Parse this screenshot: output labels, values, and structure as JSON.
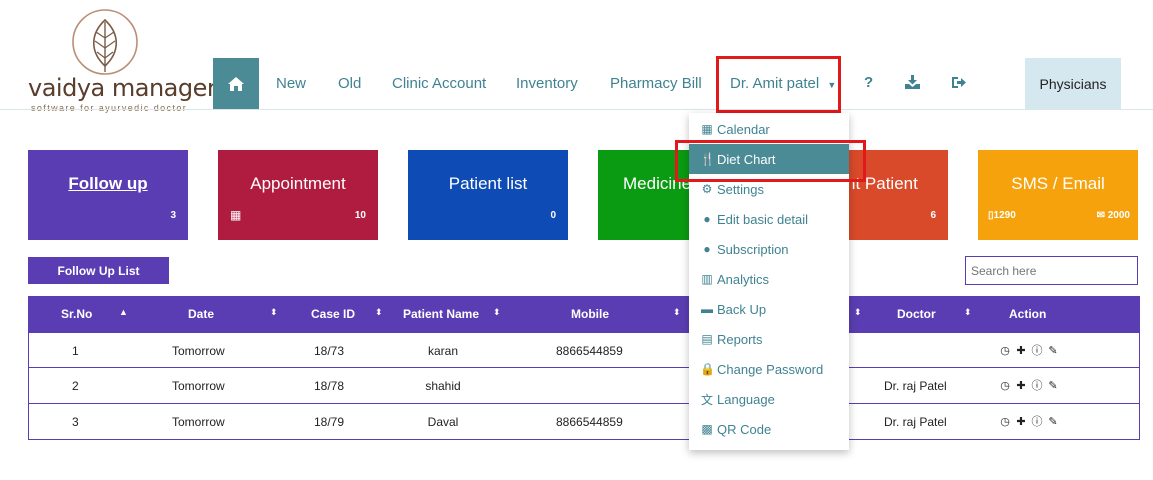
{
  "brand": {
    "name": "vaidya manager",
    "tagline": "software for ayurvedic doctor"
  },
  "nav": {
    "home_icon": "home-icon",
    "items": [
      "New",
      "Old",
      "Clinic Account",
      "Inventory",
      "Pharmacy Bill"
    ],
    "user": "Dr. Amit patel",
    "help_icon": "?",
    "physicians": "Physicians"
  },
  "tiles": [
    {
      "title": "Follow up",
      "count": "3",
      "color": "#5b3db3"
    },
    {
      "title": "Appointment",
      "count": "10",
      "color": "#b01b40"
    },
    {
      "title": "Patient list",
      "count": "0",
      "color": "#0f4bb5"
    },
    {
      "title": "Medicine",
      "count": "",
      "color": "#0b9b12"
    },
    {
      "title": "nt Patient",
      "count": "6",
      "color": "#d94a2b"
    },
    {
      "title": "SMS / Email",
      "sms_count": "1290",
      "email_count": "2000",
      "color": "#f5a20c"
    }
  ],
  "followup_list_button": "Follow Up List",
  "search": {
    "placeholder": "Search here"
  },
  "table": {
    "headers": [
      "Sr.No",
      "Date",
      "Case ID",
      "Patient Name",
      "Mobile",
      "Doctor",
      "Action"
    ],
    "rows": [
      {
        "sr": "1",
        "date": "Tomorrow",
        "case_id": "18/73",
        "name": "karan",
        "mobile": "8866544859",
        "doctor": ""
      },
      {
        "sr": "2",
        "date": "Tomorrow",
        "case_id": "18/78",
        "name": "shahid",
        "mobile": "",
        "doctor": "Dr. raj Patel"
      },
      {
        "sr": "3",
        "date": "Tomorrow",
        "case_id": "18/79",
        "name": "Daval",
        "mobile": "8866544859",
        "doctor": "Dr. raj Patel"
      }
    ]
  },
  "dropdown": {
    "items": [
      {
        "label": "Calendar",
        "icon": "calendar-icon"
      },
      {
        "label": "Diet Chart",
        "icon": "cutlery-icon"
      },
      {
        "label": "Settings",
        "icon": "gear-icon"
      },
      {
        "label": "Edit basic detail",
        "icon": "user-icon"
      },
      {
        "label": "Subscription",
        "icon": "user-icon"
      },
      {
        "label": "Analytics",
        "icon": "bar-chart-icon"
      },
      {
        "label": "Back Up",
        "icon": "hdd-icon"
      },
      {
        "label": "Reports",
        "icon": "file-icon"
      },
      {
        "label": "Change Password",
        "icon": "lock-icon"
      },
      {
        "label": "Language",
        "icon": "language-icon"
      },
      {
        "label": "QR Code",
        "icon": "qrcode-icon"
      }
    ]
  }
}
